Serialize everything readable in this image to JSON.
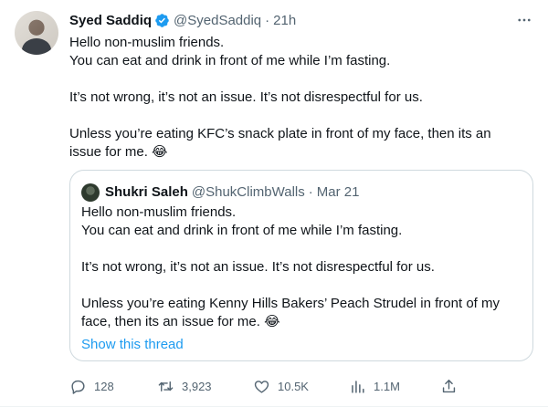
{
  "tweet": {
    "author_name": "Syed Saddiq",
    "handle": "@SyedSaddiq",
    "separator": "·",
    "time": "21h",
    "lines": [
      "Hello non-muslim friends.",
      "You can eat and drink in front of me while I’m fasting.",
      "It’s not wrong, it’s not an issue. It’s not disrespectful for us.",
      "Unless you’re eating KFC’s snack plate in front of my face, then its an",
      "issue for me. 😂"
    ],
    "colors": {
      "verified": "#1d9bf0",
      "secondary_text": "#536471",
      "link": "#1d9bf0"
    }
  },
  "quote": {
    "author_name": "Shukri Saleh",
    "handle": "@ShukClimbWalls",
    "separator": "·",
    "time": "Mar 21",
    "lines": [
      "Hello non-muslim friends.",
      "You can eat and drink in front of me while I’m fasting.",
      "It’s not wrong, it’s not an issue. It’s not disrespectful for us.",
      "Unless you’re eating Kenny Hills Bakers’ Peach Strudel in front of my",
      "face, then its an issue for me. 😂"
    ],
    "show_thread": "Show this thread"
  },
  "actions": {
    "reply_count": "128",
    "retweet_count": "3,923",
    "like_count": "10.5K",
    "views_count": "1.1M",
    "icons": [
      "reply-icon",
      "retweet-icon",
      "like-icon",
      "views-icon",
      "share-icon"
    ]
  }
}
